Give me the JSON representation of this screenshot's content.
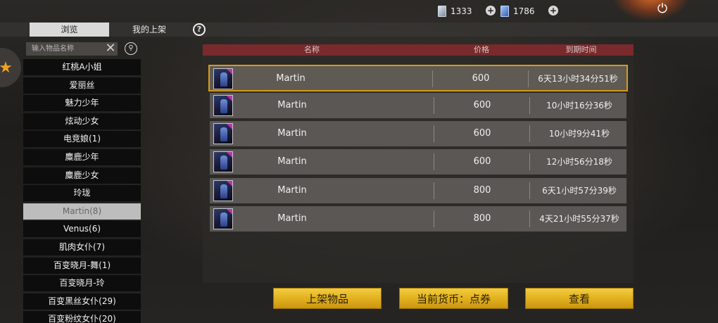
{
  "topbar": {
    "currency1_value": "1333",
    "currency2_value": "1786",
    "icons": [
      "card-icon",
      "plus-icon",
      "gem-icon",
      "plus-icon",
      "power-icon"
    ]
  },
  "tabs": [
    {
      "label": "浏览",
      "active": true
    },
    {
      "label": "我的上架",
      "active": false
    }
  ],
  "search": {
    "placeholder": "输入物品名称"
  },
  "categories": [
    {
      "label": "红桃A小姐"
    },
    {
      "label": "爱丽丝"
    },
    {
      "label": "魅力少年"
    },
    {
      "label": "炫动少女"
    },
    {
      "label": "电竞娘(1)"
    },
    {
      "label": "麋鹿少年"
    },
    {
      "label": "麋鹿少女"
    },
    {
      "label": "玲珑"
    },
    {
      "label": "Martin(8)",
      "selected": true
    },
    {
      "label": "Venus(6)"
    },
    {
      "label": "肌肉女仆(7)"
    },
    {
      "label": "百变晓月-舞(1)"
    },
    {
      "label": "百变晓月-玲"
    },
    {
      "label": "百变黑丝女仆(29)"
    },
    {
      "label": "百变粉纹女仆(20)"
    }
  ],
  "table": {
    "headers": {
      "name": "名称",
      "price": "价格",
      "expire": "到期时间"
    },
    "rows": [
      {
        "name": "Martin",
        "price": "600",
        "expire": "6天13小时34分51秒",
        "selected": true
      },
      {
        "name": "Martin",
        "price": "600",
        "expire": "10小时16分36秒"
      },
      {
        "name": "Martin",
        "price": "600",
        "expire": "10小时9分41秒"
      },
      {
        "name": "Martin",
        "price": "600",
        "expire": "12小时56分18秒"
      },
      {
        "name": "Martin",
        "price": "800",
        "expire": "6天1小时57分39秒"
      },
      {
        "name": "Martin",
        "price": "800",
        "expire": "4天21小时55分37秒"
      }
    ]
  },
  "buttons": {
    "list_item": "上架物品",
    "currency": "当前货币：点券",
    "view": "查看"
  },
  "colors": {
    "header_bg": "#7a2a2c",
    "selected_border": "#d89a1c",
    "button_gold": "#e0ae1d",
    "item_rarity": "#c02fb0"
  }
}
